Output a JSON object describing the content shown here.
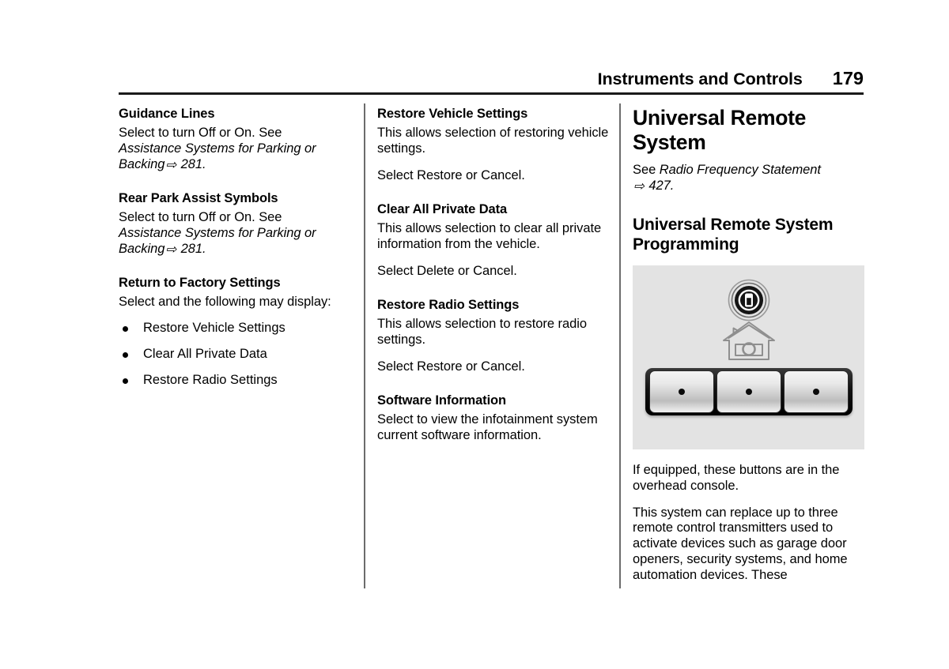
{
  "header": {
    "title": "Instruments and Controls",
    "page_number": "179"
  },
  "column1": {
    "heading1": "Guidance Lines",
    "para1_prefix": "Select to turn Off or On. See ",
    "para1_italic": "Assistance Systems for Parking or Backing",
    "para1_arrow": "⇨",
    "para1_ref": " 281.",
    "heading2": "Rear Park Assist Symbols",
    "para2_prefix": "Select to turn Off or On. See ",
    "para2_italic": "Assistance Systems for Parking or Backing",
    "para2_arrow": "⇨",
    "para2_ref": " 281.",
    "heading3": "Return to Factory Settings",
    "para3": "Select and the following may display:",
    "bullets": [
      "Restore Vehicle Settings",
      "Clear All Private Data",
      "Restore Radio Settings"
    ]
  },
  "column2": {
    "heading1": "Restore Vehicle Settings",
    "para1": "This allows selection of restoring vehicle settings.",
    "para2": "Select Restore or Cancel.",
    "heading2": "Clear All Private Data",
    "para3": "This allows selection to clear all private information from the vehicle.",
    "para4": "Select Delete or Cancel.",
    "heading3": "Restore Radio Settings",
    "para5": "This allows selection to restore radio settings.",
    "para6": "Select Restore or Cancel.",
    "heading4": "Software Information",
    "para7": "Select to view the infotainment system current software information."
  },
  "column3": {
    "main_heading": "Universal Remote System",
    "para1_prefix": "See ",
    "para1_italic": "Radio Frequency Statement",
    "para1_arrow": "⇨",
    "para1_ref": " 427.",
    "section_heading": "Universal Remote System Programming",
    "figure": {
      "logo_icon": "homelink-logo-icon",
      "house_icon": "garage-house-icon",
      "buttons": [
        {
          "dot": "button-dot-1"
        },
        {
          "dot": "button-dot-2"
        },
        {
          "dot": "button-dot-3"
        }
      ],
      "background_color": "#e3e3e3"
    },
    "para2": "If equipped, these buttons are in the overhead console.",
    "para3": "This system can replace up to three remote control transmitters used to activate devices such as garage door openers, security systems, and home automation devices. These"
  }
}
